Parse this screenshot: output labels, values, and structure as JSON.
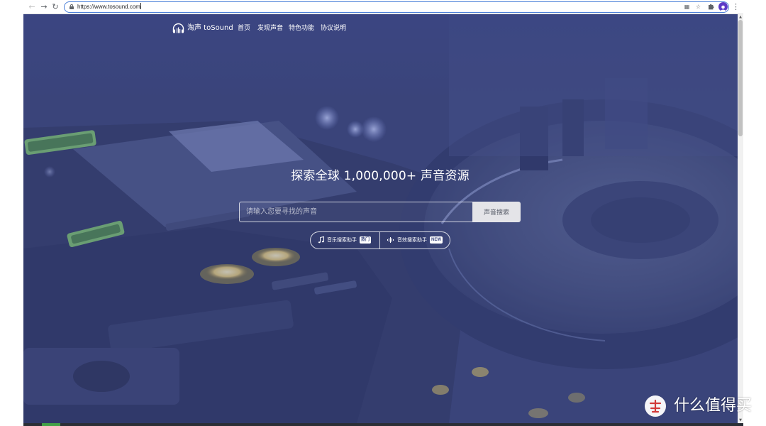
{
  "browser": {
    "url": "https://www.tosound.com"
  },
  "header": {
    "logo_text": "淘声 toSound",
    "nav": [
      {
        "label": "首页"
      },
      {
        "label": "发现声音"
      },
      {
        "label": "特色功能"
      },
      {
        "label": "协议说明"
      }
    ]
  },
  "hero": {
    "title": "探索全球 1,000,000+ 声音资源",
    "search_placeholder": "请输入您要寻找的声音",
    "search_button": "声音搜索",
    "assistants": [
      {
        "label": "音乐搜索助手",
        "badge": "热门",
        "icon": "music-note-icon"
      },
      {
        "label": "音效搜索助手",
        "badge": "NEW",
        "icon": "waveform-icon"
      }
    ]
  },
  "watermark": {
    "text": "什么值得买"
  },
  "colors": {
    "overlay": "#3e4980",
    "omnibox_border": "#4a7fd8",
    "search_button_bg": "#e4e4e8",
    "avatar": "#5b39c6"
  }
}
